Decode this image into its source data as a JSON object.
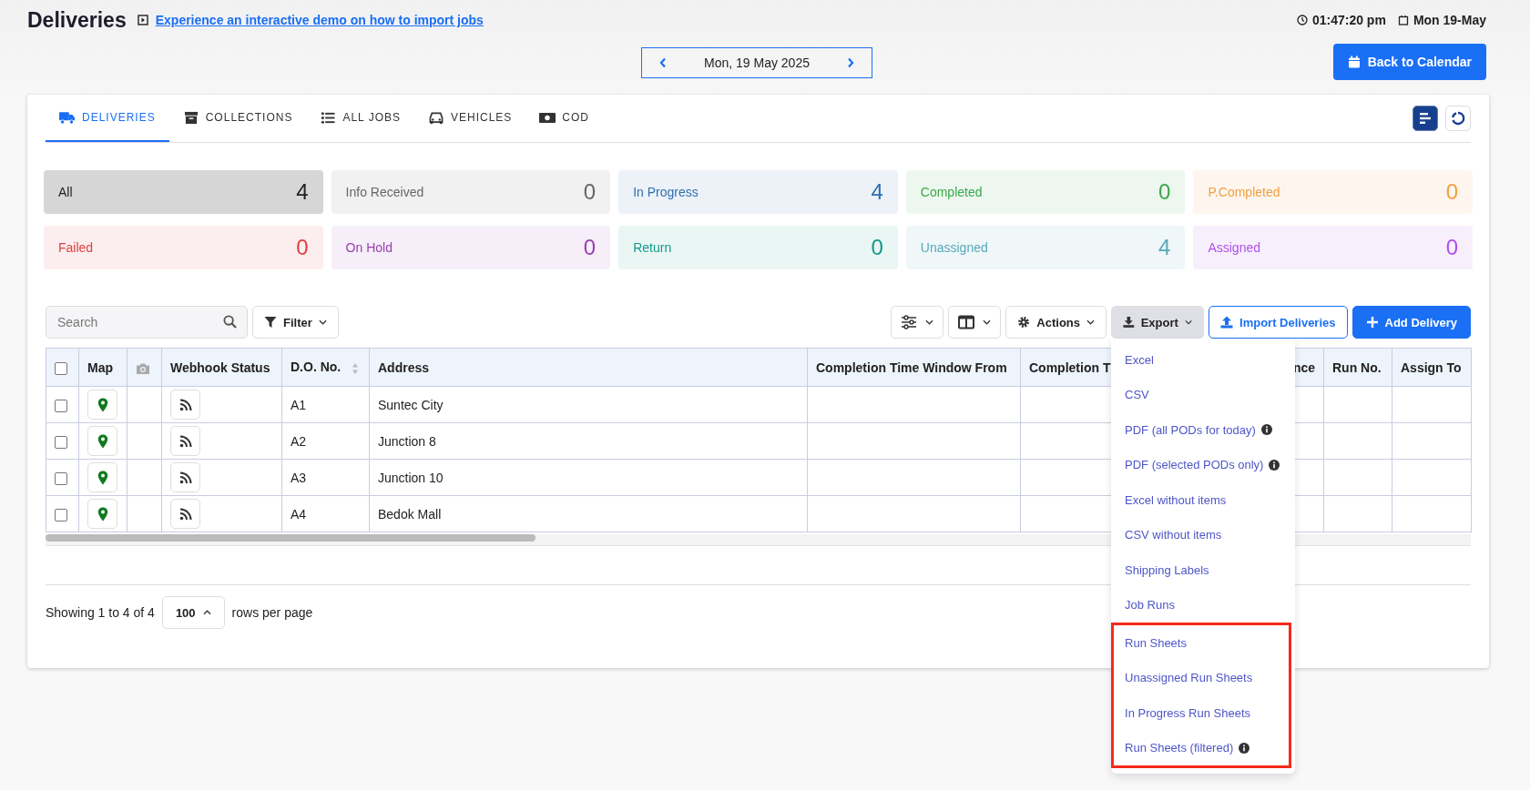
{
  "page": {
    "title": "Deliveries",
    "demo_link": "Experience an interactive demo on how to import jobs",
    "time": "01:47:20 pm",
    "date": "Mon 19-May"
  },
  "date_nav": {
    "label": "Mon, 19 May 2025"
  },
  "back_button": "Back to Calendar",
  "tabs": [
    {
      "label": "DELIVERIES",
      "selected": true
    },
    {
      "label": "COLLECTIONS",
      "selected": false
    },
    {
      "label": "ALL JOBS",
      "selected": false
    },
    {
      "label": "VEHICLES",
      "selected": false
    },
    {
      "label": "COD",
      "selected": false
    }
  ],
  "view_toggles": [
    {
      "selected": true
    },
    {
      "selected": false
    }
  ],
  "status_tiles": [
    {
      "label": "All",
      "count": "4",
      "color": "#222222",
      "selected": true
    },
    {
      "label": "Info Received",
      "count": "0",
      "color": "#666666",
      "selected": false
    },
    {
      "label": "In Progress",
      "count": "4",
      "color": "#2f6fb0",
      "selected": false
    },
    {
      "label": "Completed",
      "count": "0",
      "color": "#3aa84a",
      "selected": false
    },
    {
      "label": "P.Completed",
      "count": "0",
      "color": "#f0a040",
      "selected": false
    },
    {
      "label": "Failed",
      "count": "0",
      "color": "#e04040",
      "selected": false
    },
    {
      "label": "On Hold",
      "count": "0",
      "color": "#9a40b0",
      "selected": false
    },
    {
      "label": "Return",
      "count": "0",
      "color": "#11998a",
      "selected": false
    },
    {
      "label": "Unassigned",
      "count": "4",
      "color": "#55a8b8",
      "selected": false
    },
    {
      "label": "Assigned",
      "count": "0",
      "color": "#b050e8",
      "selected": false
    }
  ],
  "toolbar": {
    "search_placeholder": "Search",
    "filter": "Filter",
    "actions": "Actions",
    "export": "Export",
    "import": "Import Deliveries",
    "add": "Add Delivery"
  },
  "table": {
    "select_all_checked": false,
    "columns": [
      {
        "kind": "checkbox"
      },
      {
        "kind": "text",
        "label": "Map"
      },
      {
        "kind": "camera"
      },
      {
        "kind": "text",
        "label": "Webhook Status"
      },
      {
        "kind": "sort",
        "label": "D.O. No."
      },
      {
        "kind": "text",
        "label": "Address"
      },
      {
        "kind": "text",
        "label": "Completion Time Window From"
      },
      {
        "kind": "text",
        "label": "Completion T"
      },
      {
        "kind": "cut",
        "label": "nce"
      },
      {
        "kind": "text",
        "label": "Run No."
      },
      {
        "kind": "text",
        "label": "Assign To"
      }
    ],
    "rows": [
      {
        "checked": false,
        "do_no": "A1",
        "address": "Suntec City"
      },
      {
        "checked": false,
        "do_no": "A2",
        "address": "Junction 8"
      },
      {
        "checked": false,
        "do_no": "A3",
        "address": "Junction 10"
      },
      {
        "checked": false,
        "do_no": "A4",
        "address": "Bedok Mall"
      }
    ]
  },
  "footer": {
    "showing": "Showing 1 to 4 of 4",
    "page_size": "100",
    "rows_per_page": "rows per page"
  },
  "export_menu": {
    "items": [
      {
        "label": "Excel",
        "info": false
      },
      {
        "label": "CSV",
        "info": false
      },
      {
        "label": "PDF (all PODs for today)",
        "info": true
      },
      {
        "label": "PDF (selected PODs only)",
        "info": true
      },
      {
        "label": "Excel without items",
        "info": false
      },
      {
        "label": "CSV without items",
        "info": false
      },
      {
        "label": "Shipping Labels",
        "info": false
      },
      {
        "label": "Job Runs",
        "info": false
      }
    ],
    "highlighted_items": [
      {
        "label": "Run Sheets",
        "info": false
      },
      {
        "label": "Unassigned Run Sheets",
        "info": false
      },
      {
        "label": "In Progress Run Sheets",
        "info": false
      },
      {
        "label": "Run Sheets (filtered)",
        "info": true
      }
    ]
  }
}
